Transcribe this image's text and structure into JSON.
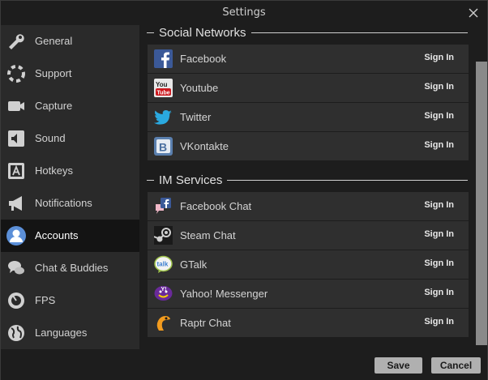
{
  "window": {
    "title": "Settings"
  },
  "sidebar": {
    "items": [
      {
        "label": "General",
        "icon": "wrench-icon"
      },
      {
        "label": "Support",
        "icon": "lifebuoy-icon"
      },
      {
        "label": "Capture",
        "icon": "video-camera-icon"
      },
      {
        "label": "Sound",
        "icon": "speaker-icon"
      },
      {
        "label": "Hotkeys",
        "icon": "key-a-icon"
      },
      {
        "label": "Notifications",
        "icon": "megaphone-icon"
      },
      {
        "label": "Accounts",
        "icon": "user-icon",
        "active": true
      },
      {
        "label": "Chat & Buddies",
        "icon": "chat-bubbles-icon"
      },
      {
        "label": "FPS",
        "icon": "gauge-icon"
      },
      {
        "label": "Languages",
        "icon": "globe-icon"
      }
    ]
  },
  "social": {
    "title": "Social Networks",
    "items": [
      {
        "name": "Facebook",
        "action": "Sign In",
        "icon": "facebook-icon"
      },
      {
        "name": "Youtube",
        "action": "Sign In",
        "icon": "youtube-icon"
      },
      {
        "name": "Twitter",
        "action": "Sign In",
        "icon": "twitter-icon"
      },
      {
        "name": "VKontakte",
        "action": "Sign In",
        "icon": "vkontakte-icon"
      }
    ]
  },
  "im": {
    "title": "IM Services",
    "items": [
      {
        "name": "Facebook Chat",
        "action": "Sign In",
        "icon": "facebook-chat-icon"
      },
      {
        "name": "Steam Chat",
        "action": "Sign In",
        "icon": "steam-icon"
      },
      {
        "name": "GTalk",
        "action": "Sign In",
        "icon": "gtalk-icon"
      },
      {
        "name": "Yahoo! Messenger",
        "action": "Sign In",
        "icon": "yahoo-messenger-icon"
      },
      {
        "name": "Raptr Chat",
        "action": "Sign In",
        "icon": "raptr-icon"
      }
    ]
  },
  "footer": {
    "save": "Save",
    "cancel": "Cancel"
  }
}
